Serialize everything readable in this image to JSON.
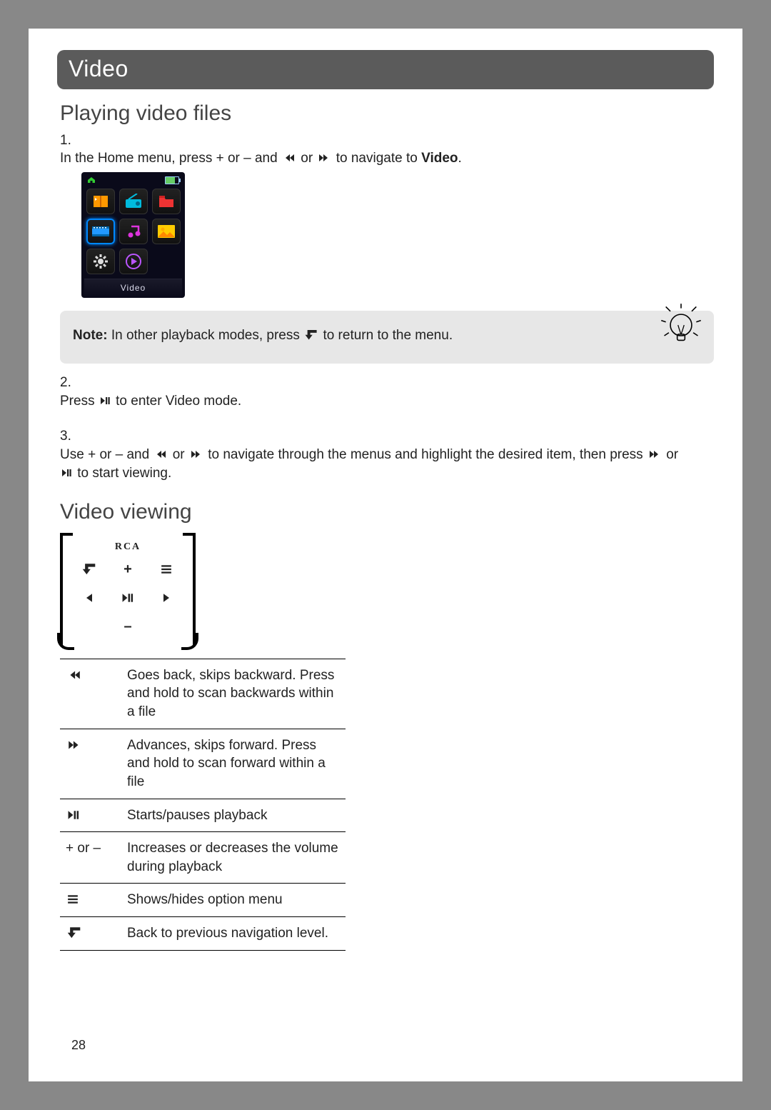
{
  "page_number": "28",
  "section_header": "Video",
  "subsection_playing": "Playing video files",
  "step1": {
    "num": "1.",
    "prefix": "In the Home menu, press + or – and ",
    "mid": " or ",
    "suffix": " to navigate to ",
    "target": "Video",
    "end": "."
  },
  "device_label": "Video",
  "note": {
    "bold": "Note:",
    "before": " In other playback modes, press ",
    "after": " to return to the menu."
  },
  "step2": {
    "num": "2.",
    "before": "Press ",
    "after": " to enter Video mode."
  },
  "step3": {
    "num": "3.",
    "part1": "Use + or – and ",
    "mid1": " or ",
    "part2": " to navigate through the menus and highlight the desired item, then press ",
    "mid2": " or ",
    "part3": " to start viewing."
  },
  "subsection_viewing": "Video viewing",
  "controller_logo": "RCA",
  "controls": [
    {
      "label_text": "",
      "desc": "Goes back, skips backward. Press and hold to scan backwards within a file"
    },
    {
      "label_text": "",
      "desc": "Advances, skips forward. Press and hold to scan forward within a file"
    },
    {
      "label_text": "",
      "desc": "Starts/pauses playback"
    },
    {
      "label_text": "+ or –",
      "desc": "Increases or decreases the volume during playback"
    },
    {
      "label_text": "",
      "desc": "Shows/hides option menu"
    },
    {
      "label_text": "",
      "desc": "Back to previous navigation level."
    }
  ]
}
